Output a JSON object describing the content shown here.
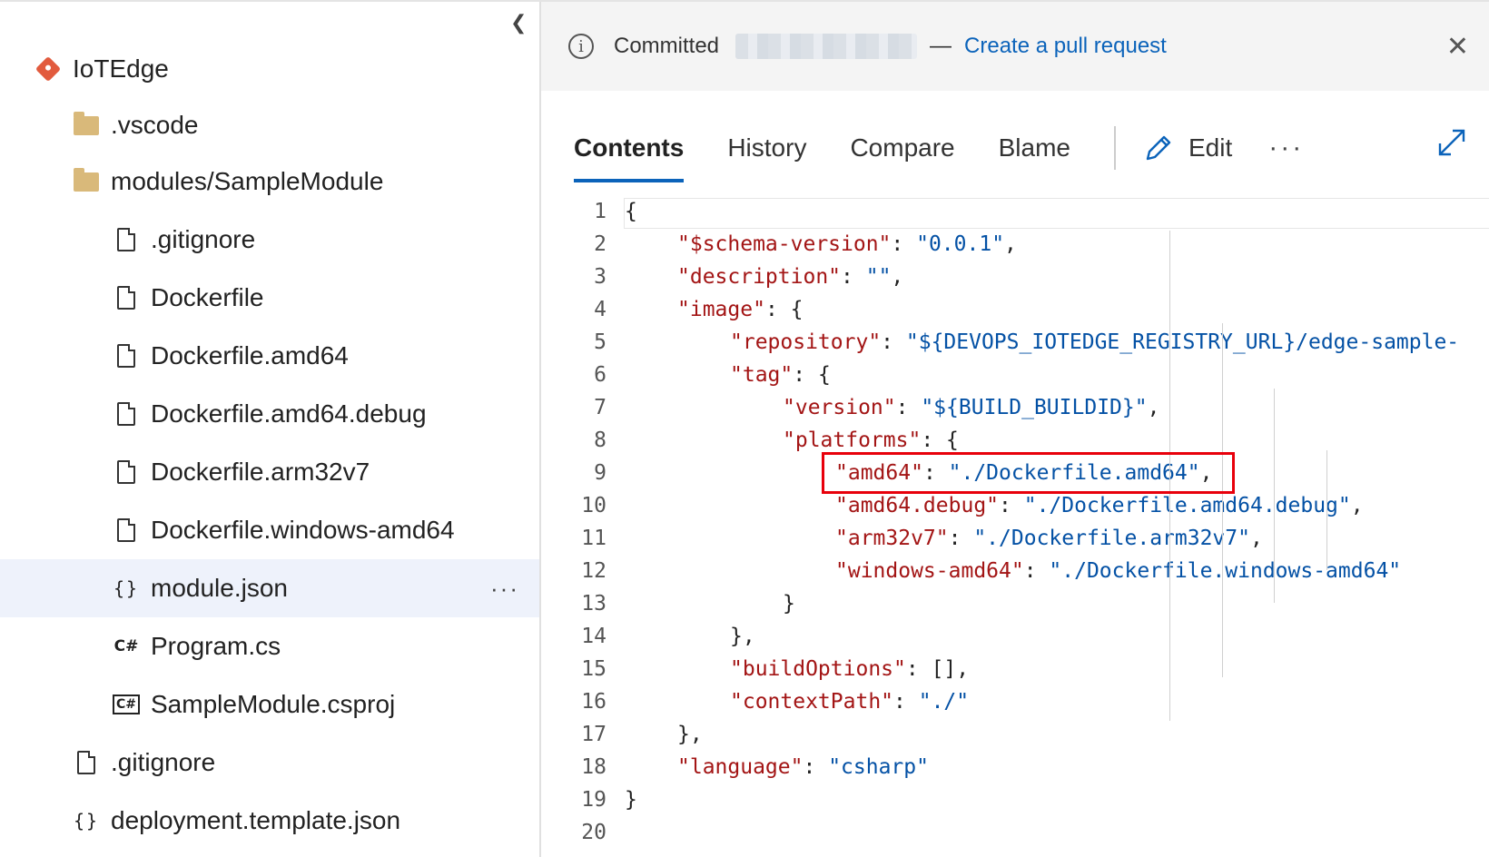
{
  "sidebar": {
    "collapse_icon": "chevron-left-icon",
    "repo": "IoTEdge",
    "items": [
      {
        "label": ".vscode",
        "icon": "folder-icon"
      },
      {
        "label": "modules/SampleModule",
        "icon": "folder-icon"
      },
      {
        "label": ".gitignore",
        "icon": "file-icon"
      },
      {
        "label": "Dockerfile",
        "icon": "file-icon"
      },
      {
        "label": "Dockerfile.amd64",
        "icon": "file-icon"
      },
      {
        "label": "Dockerfile.amd64.debug",
        "icon": "file-icon"
      },
      {
        "label": "Dockerfile.arm32v7",
        "icon": "file-icon"
      },
      {
        "label": "Dockerfile.windows-amd64",
        "icon": "file-icon"
      },
      {
        "label": "module.json",
        "icon": "json-braces-icon",
        "selected": true,
        "more": "···"
      },
      {
        "label": "Program.cs",
        "icon": "csharp-icon"
      },
      {
        "label": "SampleModule.csproj",
        "icon": "csproj-icon"
      },
      {
        "label": ".gitignore",
        "icon": "file-icon"
      },
      {
        "label": "deployment.template.json",
        "icon": "json-braces-icon"
      }
    ]
  },
  "banner": {
    "status": "Committed",
    "separator": "—",
    "link": "Create a pull request"
  },
  "tabs": {
    "contents": "Contents",
    "history": "History",
    "compare": "Compare",
    "blame": "Blame",
    "edit": "Edit",
    "more": "···"
  },
  "code": {
    "line_numbers": [
      "1",
      "2",
      "3",
      "4",
      "5",
      "6",
      "7",
      "8",
      "9",
      "10",
      "11",
      "12",
      "13",
      "14",
      "15",
      "16",
      "17",
      "18",
      "19",
      "20"
    ],
    "lines": [
      {
        "k": "",
        "p": "{",
        "s": "",
        "e": ""
      },
      {
        "k": "\"$schema-version\"",
        "p": ": ",
        "s": "\"0.0.1\"",
        "e": ","
      },
      {
        "k": "\"description\"",
        "p": ": ",
        "s": "\"\"",
        "e": ","
      },
      {
        "k": "\"image\"",
        "p": ": {",
        "s": "",
        "e": ""
      },
      {
        "k": "\"repository\"",
        "p": ": ",
        "s": "\"${DEVOPS_IOTEDGE_REGISTRY_URL}/edge-sample-",
        "e": ""
      },
      {
        "k": "\"tag\"",
        "p": ": {",
        "s": "",
        "e": ""
      },
      {
        "k": "\"version\"",
        "p": ": ",
        "s": "\"${BUILD_BUILDID}\"",
        "e": ","
      },
      {
        "k": "\"platforms\"",
        "p": ": {",
        "s": "",
        "e": ""
      },
      {
        "k": "\"amd64\"",
        "p": ": ",
        "s": "\"./Dockerfile.amd64\"",
        "e": ","
      },
      {
        "k": "\"amd64.debug\"",
        "p": ": ",
        "s": "\"./Dockerfile.amd64.debug\"",
        "e": ","
      },
      {
        "k": "\"arm32v7\"",
        "p": ": ",
        "s": "\"./Dockerfile.arm32v7\"",
        "e": ","
      },
      {
        "k": "\"windows-amd64\"",
        "p": ": ",
        "s": "\"./Dockerfile.windows-amd64\"",
        "e": ""
      },
      {
        "k": "",
        "p": "}",
        "s": "",
        "e": ""
      },
      {
        "k": "",
        "p": "},",
        "s": "",
        "e": ""
      },
      {
        "k": "\"buildOptions\"",
        "p": ": [],",
        "s": "",
        "e": ""
      },
      {
        "k": "\"contextPath\"",
        "p": ": ",
        "s": "\"./\"",
        "e": ""
      },
      {
        "k": "",
        "p": "},",
        "s": "",
        "e": ""
      },
      {
        "k": "\"language\"",
        "p": ": ",
        "s": "\"csharp\"",
        "e": ""
      },
      {
        "k": "",
        "p": "}",
        "s": "",
        "e": ""
      },
      {
        "k": "",
        "p": "",
        "s": "",
        "e": ""
      }
    ]
  },
  "colors": {
    "accent": "#0b63ba",
    "key": "#a31515",
    "string": "#0451a5",
    "highlight_box": "#e8000b",
    "selected_row": "#eef2fb"
  }
}
